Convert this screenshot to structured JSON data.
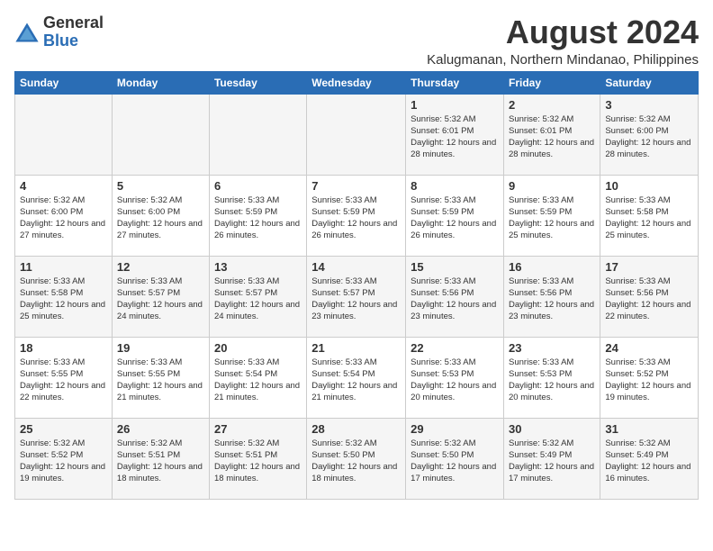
{
  "header": {
    "logo_general": "General",
    "logo_blue": "Blue",
    "month_year": "August 2024",
    "location": "Kalugmanan, Northern Mindanao, Philippines"
  },
  "calendar": {
    "days_of_week": [
      "Sunday",
      "Monday",
      "Tuesday",
      "Wednesday",
      "Thursday",
      "Friday",
      "Saturday"
    ],
    "weeks": [
      [
        {
          "day": "",
          "sunrise": "",
          "sunset": "",
          "daylight": ""
        },
        {
          "day": "",
          "sunrise": "",
          "sunset": "",
          "daylight": ""
        },
        {
          "day": "",
          "sunrise": "",
          "sunset": "",
          "daylight": ""
        },
        {
          "day": "",
          "sunrise": "",
          "sunset": "",
          "daylight": ""
        },
        {
          "day": "1",
          "sunrise": "Sunrise: 5:32 AM",
          "sunset": "Sunset: 6:01 PM",
          "daylight": "Daylight: 12 hours and 28 minutes."
        },
        {
          "day": "2",
          "sunrise": "Sunrise: 5:32 AM",
          "sunset": "Sunset: 6:01 PM",
          "daylight": "Daylight: 12 hours and 28 minutes."
        },
        {
          "day": "3",
          "sunrise": "Sunrise: 5:32 AM",
          "sunset": "Sunset: 6:00 PM",
          "daylight": "Daylight: 12 hours and 28 minutes."
        }
      ],
      [
        {
          "day": "4",
          "sunrise": "Sunrise: 5:32 AM",
          "sunset": "Sunset: 6:00 PM",
          "daylight": "Daylight: 12 hours and 27 minutes."
        },
        {
          "day": "5",
          "sunrise": "Sunrise: 5:32 AM",
          "sunset": "Sunset: 6:00 PM",
          "daylight": "Daylight: 12 hours and 27 minutes."
        },
        {
          "day": "6",
          "sunrise": "Sunrise: 5:33 AM",
          "sunset": "Sunset: 5:59 PM",
          "daylight": "Daylight: 12 hours and 26 minutes."
        },
        {
          "day": "7",
          "sunrise": "Sunrise: 5:33 AM",
          "sunset": "Sunset: 5:59 PM",
          "daylight": "Daylight: 12 hours and 26 minutes."
        },
        {
          "day": "8",
          "sunrise": "Sunrise: 5:33 AM",
          "sunset": "Sunset: 5:59 PM",
          "daylight": "Daylight: 12 hours and 26 minutes."
        },
        {
          "day": "9",
          "sunrise": "Sunrise: 5:33 AM",
          "sunset": "Sunset: 5:59 PM",
          "daylight": "Daylight: 12 hours and 25 minutes."
        },
        {
          "day": "10",
          "sunrise": "Sunrise: 5:33 AM",
          "sunset": "Sunset: 5:58 PM",
          "daylight": "Daylight: 12 hours and 25 minutes."
        }
      ],
      [
        {
          "day": "11",
          "sunrise": "Sunrise: 5:33 AM",
          "sunset": "Sunset: 5:58 PM",
          "daylight": "Daylight: 12 hours and 25 minutes."
        },
        {
          "day": "12",
          "sunrise": "Sunrise: 5:33 AM",
          "sunset": "Sunset: 5:57 PM",
          "daylight": "Daylight: 12 hours and 24 minutes."
        },
        {
          "day": "13",
          "sunrise": "Sunrise: 5:33 AM",
          "sunset": "Sunset: 5:57 PM",
          "daylight": "Daylight: 12 hours and 24 minutes."
        },
        {
          "day": "14",
          "sunrise": "Sunrise: 5:33 AM",
          "sunset": "Sunset: 5:57 PM",
          "daylight": "Daylight: 12 hours and 23 minutes."
        },
        {
          "day": "15",
          "sunrise": "Sunrise: 5:33 AM",
          "sunset": "Sunset: 5:56 PM",
          "daylight": "Daylight: 12 hours and 23 minutes."
        },
        {
          "day": "16",
          "sunrise": "Sunrise: 5:33 AM",
          "sunset": "Sunset: 5:56 PM",
          "daylight": "Daylight: 12 hours and 23 minutes."
        },
        {
          "day": "17",
          "sunrise": "Sunrise: 5:33 AM",
          "sunset": "Sunset: 5:56 PM",
          "daylight": "Daylight: 12 hours and 22 minutes."
        }
      ],
      [
        {
          "day": "18",
          "sunrise": "Sunrise: 5:33 AM",
          "sunset": "Sunset: 5:55 PM",
          "daylight": "Daylight: 12 hours and 22 minutes."
        },
        {
          "day": "19",
          "sunrise": "Sunrise: 5:33 AM",
          "sunset": "Sunset: 5:55 PM",
          "daylight": "Daylight: 12 hours and 21 minutes."
        },
        {
          "day": "20",
          "sunrise": "Sunrise: 5:33 AM",
          "sunset": "Sunset: 5:54 PM",
          "daylight": "Daylight: 12 hours and 21 minutes."
        },
        {
          "day": "21",
          "sunrise": "Sunrise: 5:33 AM",
          "sunset": "Sunset: 5:54 PM",
          "daylight": "Daylight: 12 hours and 21 minutes."
        },
        {
          "day": "22",
          "sunrise": "Sunrise: 5:33 AM",
          "sunset": "Sunset: 5:53 PM",
          "daylight": "Daylight: 12 hours and 20 minutes."
        },
        {
          "day": "23",
          "sunrise": "Sunrise: 5:33 AM",
          "sunset": "Sunset: 5:53 PM",
          "daylight": "Daylight: 12 hours and 20 minutes."
        },
        {
          "day": "24",
          "sunrise": "Sunrise: 5:33 AM",
          "sunset": "Sunset: 5:52 PM",
          "daylight": "Daylight: 12 hours and 19 minutes."
        }
      ],
      [
        {
          "day": "25",
          "sunrise": "Sunrise: 5:32 AM",
          "sunset": "Sunset: 5:52 PM",
          "daylight": "Daylight: 12 hours and 19 minutes."
        },
        {
          "day": "26",
          "sunrise": "Sunrise: 5:32 AM",
          "sunset": "Sunset: 5:51 PM",
          "daylight": "Daylight: 12 hours and 18 minutes."
        },
        {
          "day": "27",
          "sunrise": "Sunrise: 5:32 AM",
          "sunset": "Sunset: 5:51 PM",
          "daylight": "Daylight: 12 hours and 18 minutes."
        },
        {
          "day": "28",
          "sunrise": "Sunrise: 5:32 AM",
          "sunset": "Sunset: 5:50 PM",
          "daylight": "Daylight: 12 hours and 18 minutes."
        },
        {
          "day": "29",
          "sunrise": "Sunrise: 5:32 AM",
          "sunset": "Sunset: 5:50 PM",
          "daylight": "Daylight: 12 hours and 17 minutes."
        },
        {
          "day": "30",
          "sunrise": "Sunrise: 5:32 AM",
          "sunset": "Sunset: 5:49 PM",
          "daylight": "Daylight: 12 hours and 17 minutes."
        },
        {
          "day": "31",
          "sunrise": "Sunrise: 5:32 AM",
          "sunset": "Sunset: 5:49 PM",
          "daylight": "Daylight: 12 hours and 16 minutes."
        }
      ]
    ]
  }
}
